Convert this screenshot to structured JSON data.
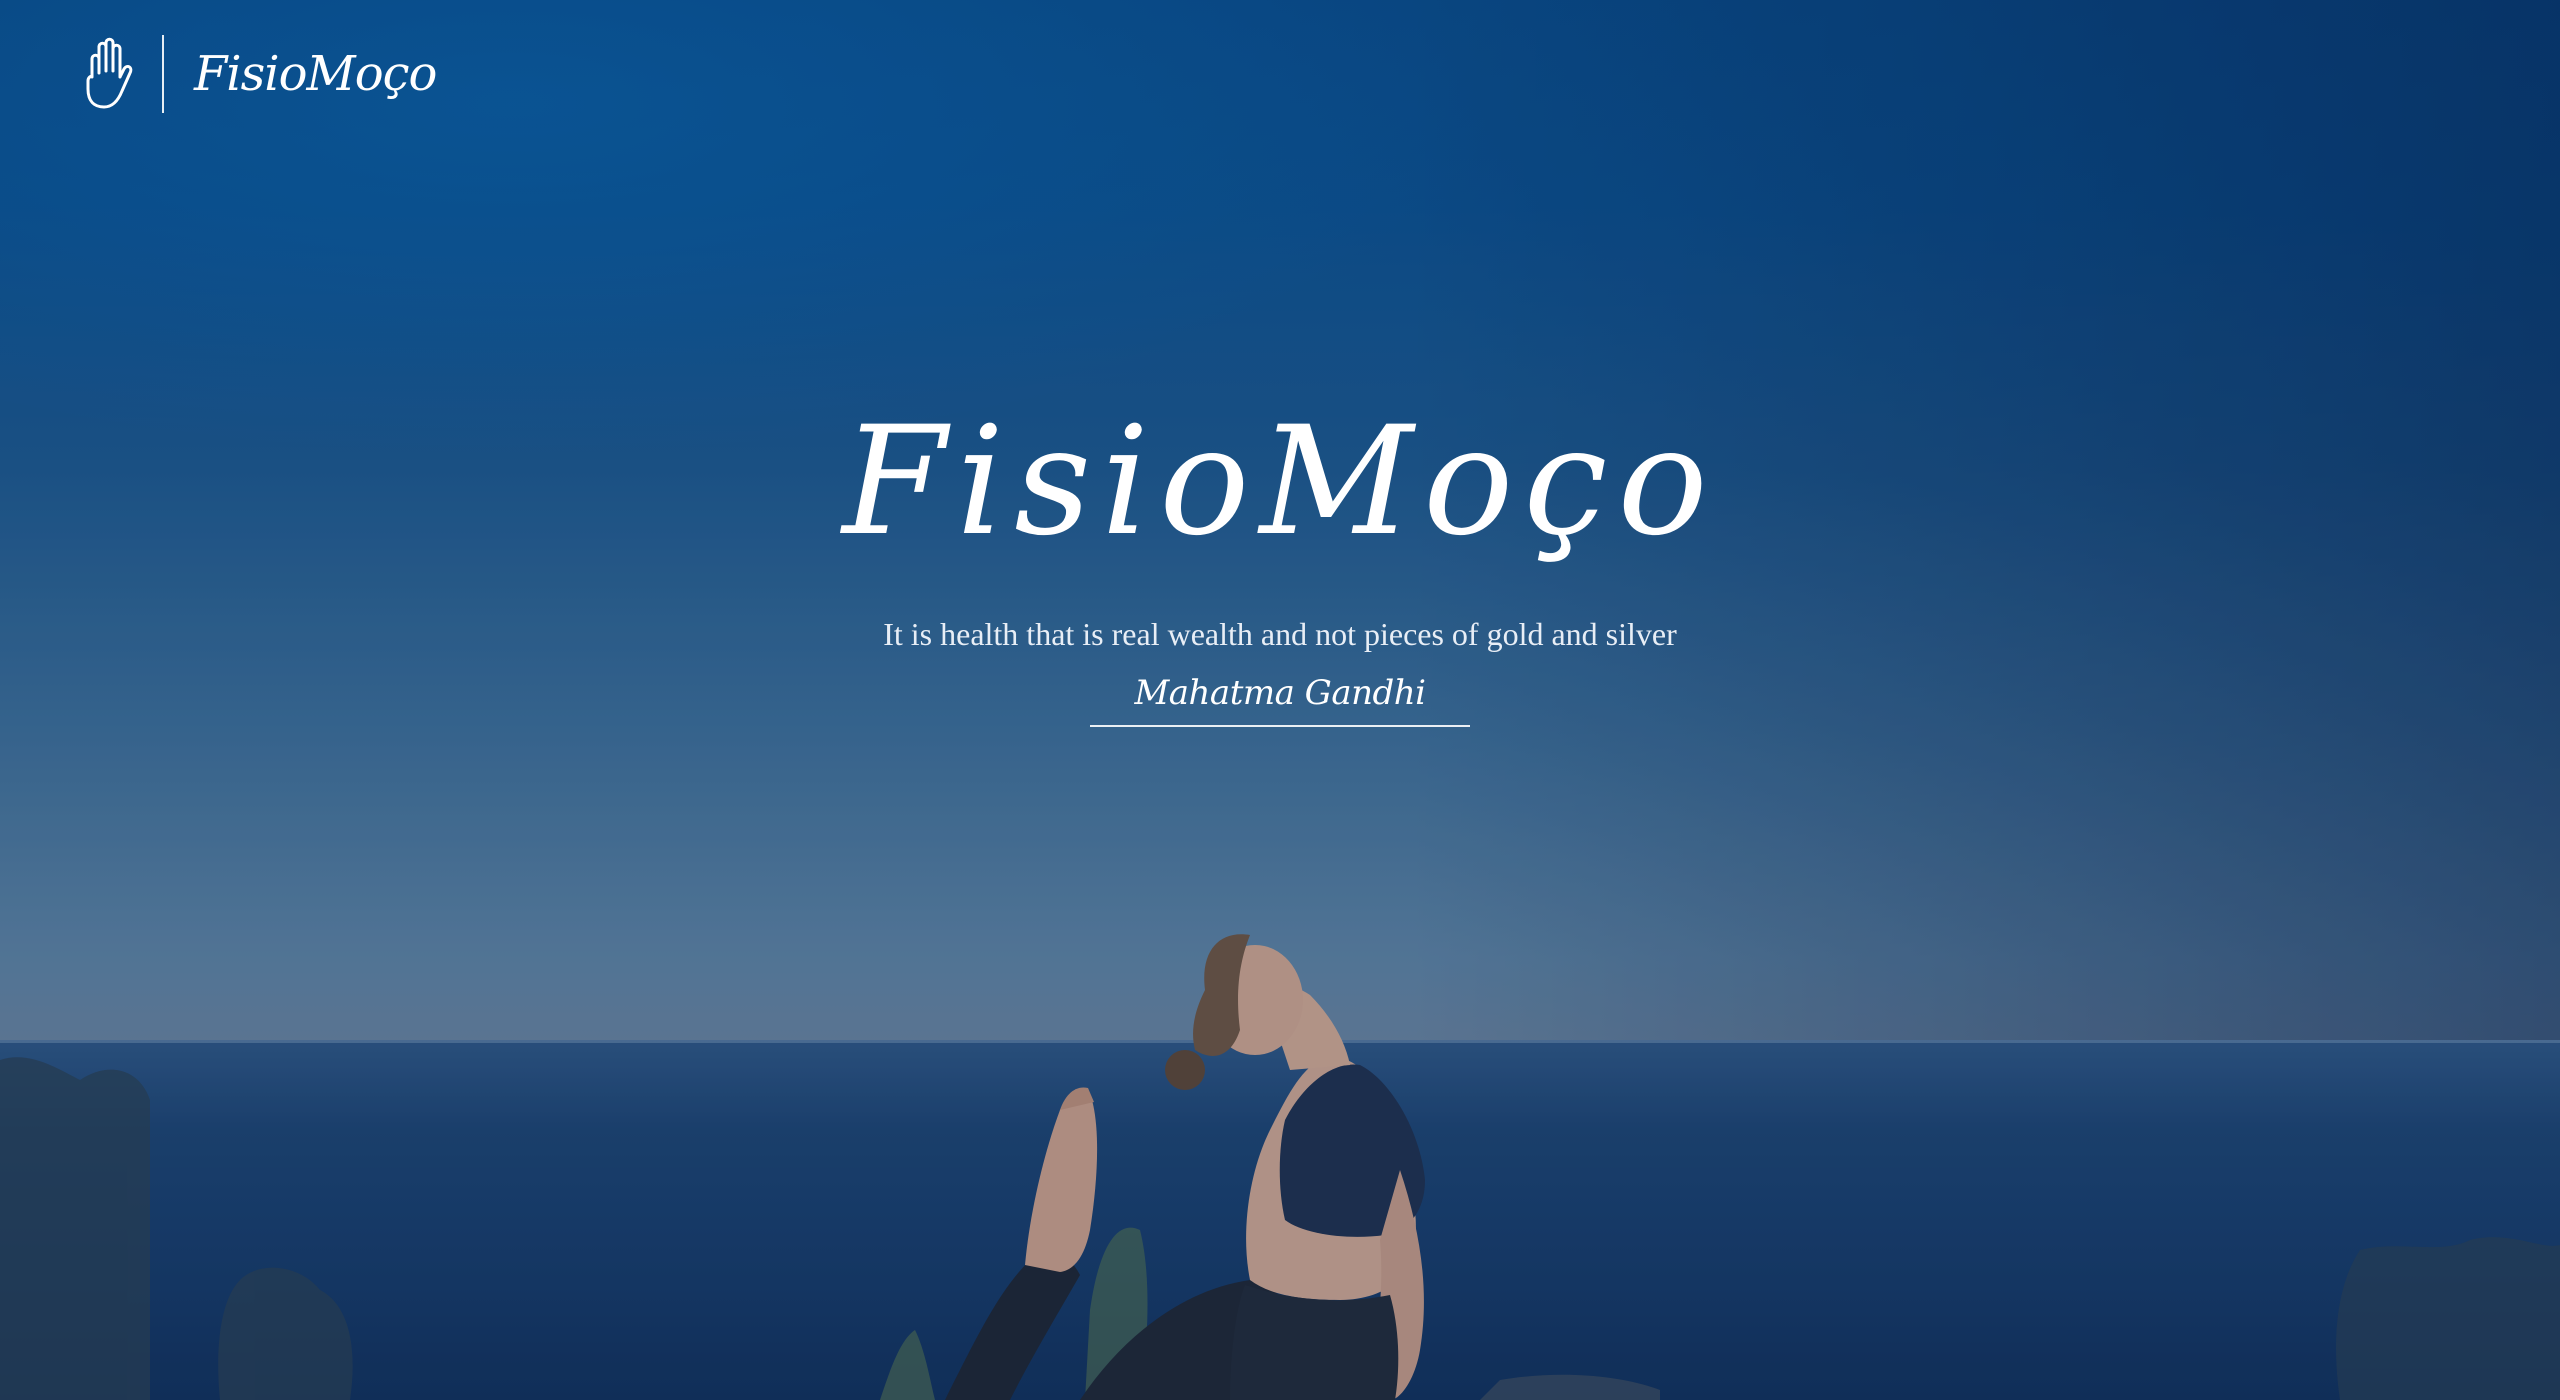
{
  "header": {
    "logo_icon": "raised-hand-icon",
    "brand": "FisioMoço"
  },
  "hero": {
    "title": "FisioMoço",
    "quote": "It is health that is real wealth and not pieces of gold and silver",
    "author": "Mahatma Gandhi"
  },
  "background": {
    "description_colors": {
      "sky_top": "#0a4a86",
      "sky_horizon": "#667f99",
      "sea": "#173a66"
    }
  }
}
